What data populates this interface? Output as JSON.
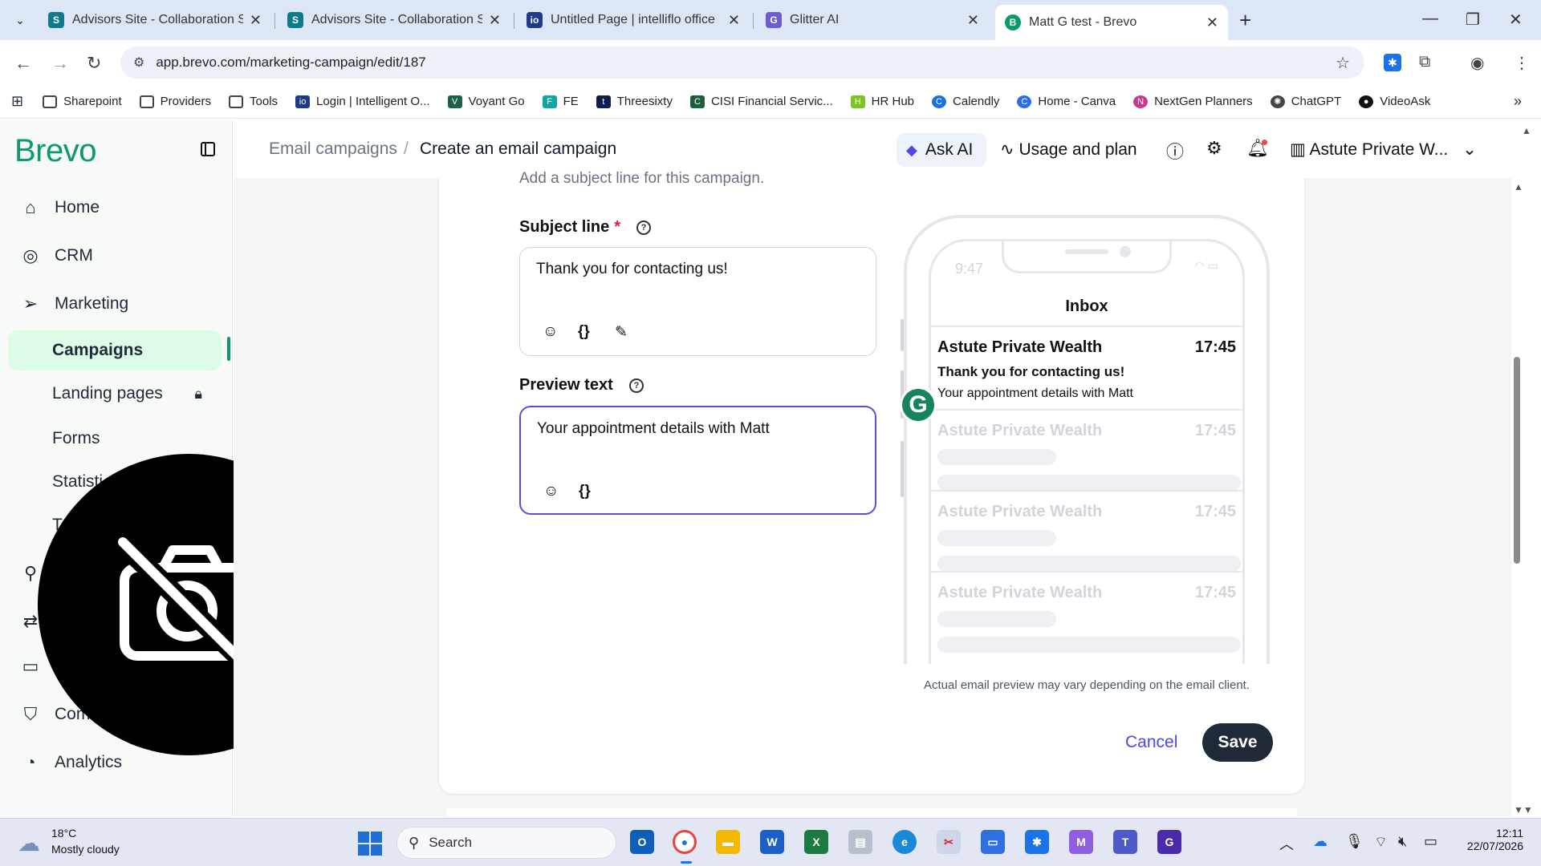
{
  "browser": {
    "tabs": [
      {
        "title": "Advisors Site - Collaboration Sit",
        "color": "#0f7b8a"
      },
      {
        "title": "Advisors Site - Collaboration Sit",
        "color": "#0f7b8a"
      },
      {
        "title": "Untitled Page | intelliflo office",
        "color": "#1e3a8a"
      },
      {
        "title": "Glitter AI",
        "color": "#6d5bd0"
      },
      {
        "title": "Matt G test - Brevo",
        "color": "#0b996e"
      }
    ],
    "url": "app.brevo.com/marketing-campaign/edit/187",
    "bookmarks": [
      {
        "label": "Sharepoint",
        "icon": "folder-icon"
      },
      {
        "label": "Providers",
        "icon": "folder-icon"
      },
      {
        "label": "Tools",
        "icon": "folder-icon"
      },
      {
        "label": "Login | Intelligent O...",
        "icon": "intelliflo-icon"
      },
      {
        "label": "Voyant Go",
        "icon": "voyant-icon"
      },
      {
        "label": "FE",
        "icon": "fe-icon"
      },
      {
        "label": "Threesixty",
        "icon": "threesixty-icon"
      },
      {
        "label": "CISI Financial Servic...",
        "icon": "cisi-icon"
      },
      {
        "label": "HR Hub",
        "icon": "hrhub-icon"
      },
      {
        "label": "Calendly",
        "icon": "calendly-icon"
      },
      {
        "label": "Home - Canva",
        "icon": "canva-icon"
      },
      {
        "label": "NextGen Planners",
        "icon": "nextgen-icon"
      },
      {
        "label": "ChatGPT",
        "icon": "chatgpt-icon"
      },
      {
        "label": "VideoAsk",
        "icon": "videoask-icon"
      }
    ]
  },
  "app": {
    "logo": "Brevo",
    "nav": {
      "home": "Home",
      "crm": "CRM",
      "marketing": "Marketing",
      "campaigns": "Campaigns",
      "landing_pages": "Landing pages",
      "forms": "Forms",
      "statistics": "Statisti",
      "partial_t": "T",
      "commerce": "Comm",
      "analytics": "Analytics"
    },
    "header": {
      "crumb_parent": "Email campaigns",
      "crumb_sep": "/",
      "crumb_current": "Create an email campaign",
      "ask_ai": "Ask AI",
      "usage": "Usage and plan",
      "account": "Astute Private W..."
    },
    "form": {
      "cut_text": "Add a subject line for this campaign.",
      "subject_label": "Subject line",
      "required_mark": "*",
      "subject_value": "Thank you for contacting us!",
      "preview_label": "Preview text",
      "preview_value": "Your appointment details with Matt",
      "cancel": "Cancel",
      "save": "Save"
    },
    "phone": {
      "time": "9:47",
      "inbox_title": "Inbox",
      "messages": [
        {
          "sender": "Astute Private Wealth",
          "time": "17:45",
          "subject": "Thank you for contacting us!",
          "preview": "Your appointment details with Matt"
        },
        {
          "sender": "Astute Private Wealth",
          "time": "17:45"
        },
        {
          "sender": "Astute Private Wealth",
          "time": "17:45"
        },
        {
          "sender": "Astute Private Wealth",
          "time": "17:45"
        }
      ],
      "disclaimer": "Actual email preview may vary depending on the email client."
    }
  },
  "taskbar": {
    "temp": "18°C",
    "weather": "Mostly cloudy",
    "search": "Search",
    "time": "12:11",
    "date": "22/07/2026"
  }
}
